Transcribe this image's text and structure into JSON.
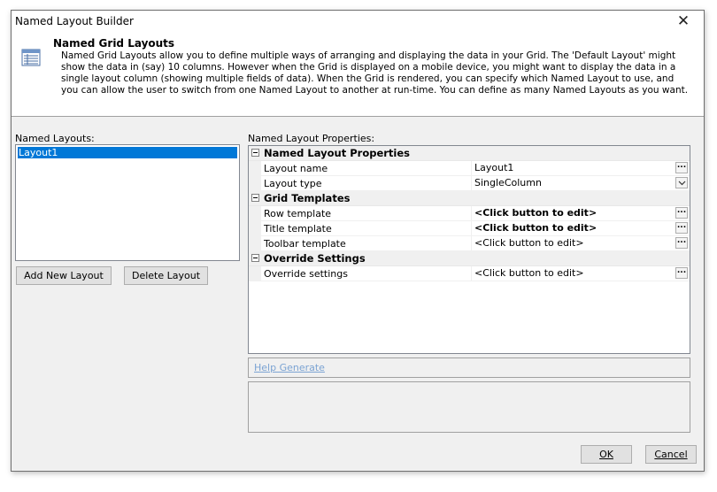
{
  "window": {
    "title": "Named Layout Builder"
  },
  "header": {
    "title": "Named Grid Layouts",
    "description": "Named Grid Layouts allow you to define multiple ways of arranging and displaying the data in your Grid. The 'Default Layout' might show the data in (say) 10 columns. However when the Grid is displayed on a mobile device, you might want to display the data in a single layout column (showing multiple fields of data). When the Grid is rendered, you can specify which Named Layout to use, and you can allow the user to switch from one Named Layout to another at run-time. You can define as many Named Layouts as you want."
  },
  "left": {
    "label": "Named Layouts:",
    "items": [
      "Layout1"
    ],
    "add_label": "Add New Layout",
    "delete_label": "Delete Layout"
  },
  "properties": {
    "label": "Named Layout Properties:",
    "categories": [
      {
        "name": "Named Layout Properties",
        "rows": [
          {
            "name": "Layout name",
            "value": "Layout1"
          },
          {
            "name": "Layout type",
            "value": "SingleColumn"
          }
        ]
      },
      {
        "name": "Grid Templates",
        "rows": [
          {
            "name": "Row template",
            "value": "<Click button to edit>"
          },
          {
            "name": "Title template",
            "value": "<Click button to edit>"
          },
          {
            "name": "Toolbar template",
            "value": "<Click button to edit>"
          }
        ]
      },
      {
        "name": "Override Settings",
        "rows": [
          {
            "name": "Override settings",
            "value": "<Click button to edit>"
          }
        ]
      }
    ]
  },
  "help": {
    "link": "Help Generate"
  },
  "footer": {
    "ok_label": "OK",
    "cancel_label": "Cancel"
  }
}
